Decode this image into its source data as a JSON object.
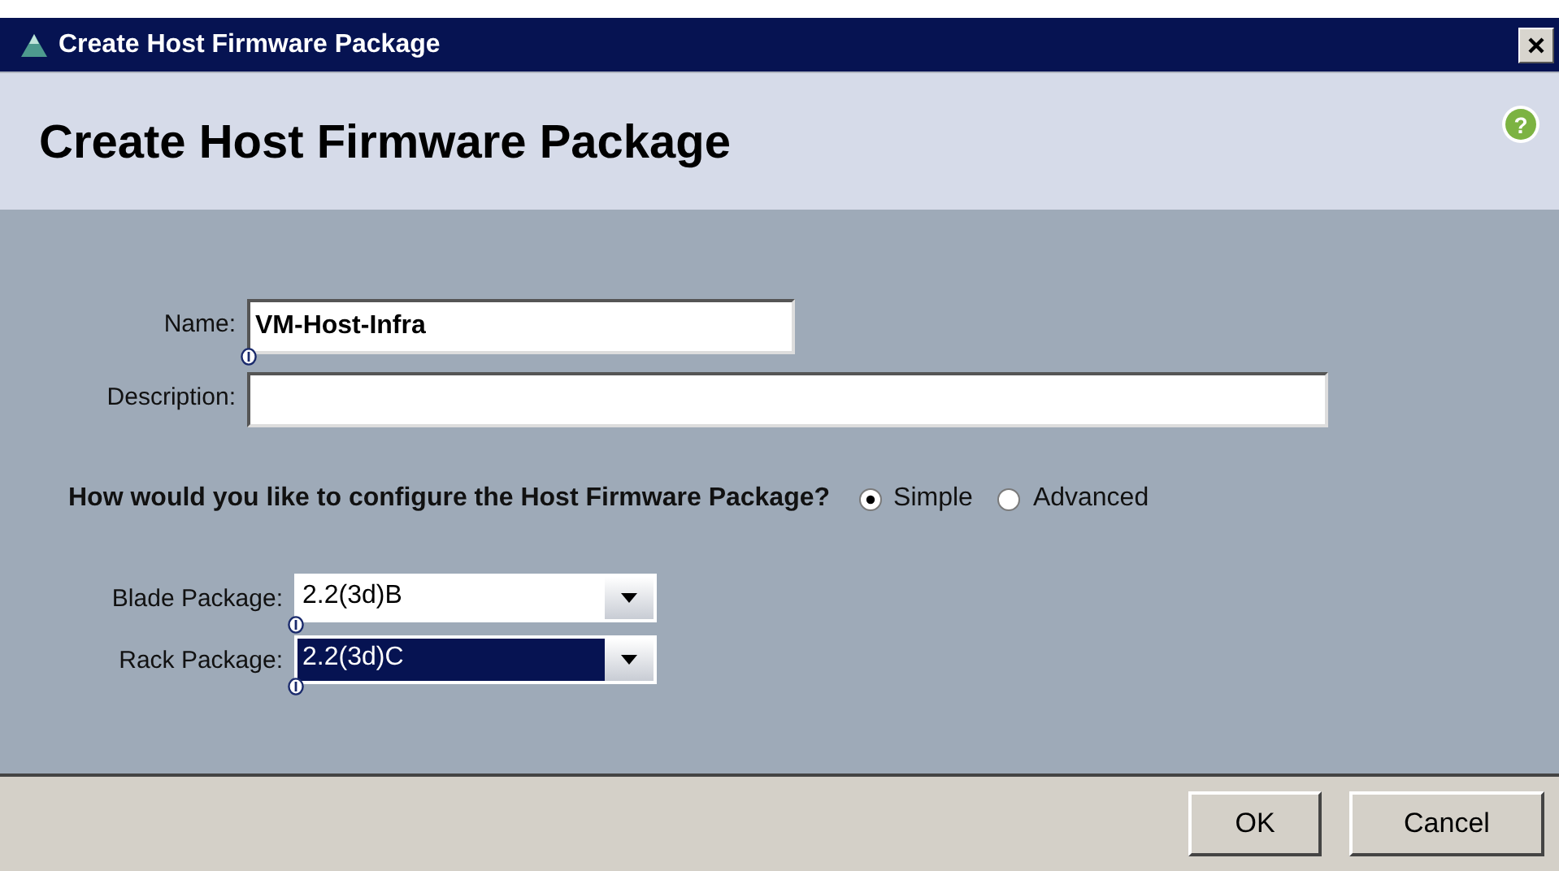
{
  "window": {
    "title": "Create Host Firmware Package"
  },
  "header": {
    "title": "Create Host Firmware Package",
    "help": "?"
  },
  "fields": [
    {
      "label": "Name:",
      "value": "VM-Host-Infra"
    },
    {
      "label": "Description:"
    }
  ],
  "question": {
    "text": "How would you like to configure the Host Firmware Package?",
    "options": [
      {
        "label": "Simple",
        "selected": true
      },
      {
        "label": "Advanced",
        "selected": false
      }
    ]
  },
  "packages": [
    {
      "label": "Blade Package:",
      "value": "2.2(3d)B",
      "highlighted": false
    },
    {
      "label": "Rack Package:",
      "value": "2.2(3d)C",
      "highlighted": true
    }
  ],
  "buttons": [
    "OK",
    "Cancel"
  ]
}
